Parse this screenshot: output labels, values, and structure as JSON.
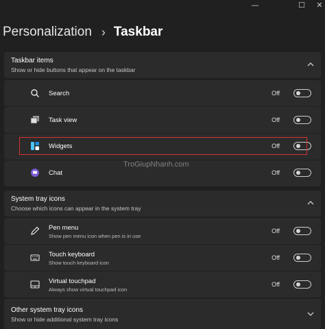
{
  "window": {
    "minimize_glyph": "—",
    "maximize_glyph": "☐",
    "close_glyph": "✕"
  },
  "breadcrumb": {
    "parent": "Personalization",
    "separator": "›",
    "current": "Taskbar"
  },
  "taskbar_items": {
    "title": "Taskbar items",
    "subtitle": "Show or hide buttons that appear on the taskbar",
    "expanded_icon": "chevron-up-icon",
    "items": [
      {
        "label": "Search",
        "state": "Off",
        "icon": "search-icon"
      },
      {
        "label": "Task view",
        "state": "Off",
        "icon": "task-view-icon"
      },
      {
        "label": "Widgets",
        "state": "Off",
        "icon": "widgets-icon"
      },
      {
        "label": "Chat",
        "state": "Off",
        "icon": "chat-icon"
      }
    ]
  },
  "system_tray": {
    "title": "System tray icons",
    "subtitle": "Choose which icons can appear in the system tray",
    "expanded_icon": "chevron-up-icon",
    "items": [
      {
        "label": "Pen menu",
        "description": "Show pen menu icon when pen is in use",
        "state": "Off",
        "icon": "pen-icon"
      },
      {
        "label": "Touch keyboard",
        "description": "Show touch keyboard icon",
        "state": "Off",
        "icon": "keyboard-icon"
      },
      {
        "label": "Virtual touchpad",
        "description": "Always show virtual touchpad icon",
        "state": "Off",
        "icon": "touchpad-icon"
      }
    ]
  },
  "other_tray": {
    "title": "Other system tray icons",
    "subtitle": "Show or hide additional system tray icons",
    "collapsed_icon": "chevron-down-icon"
  },
  "watermark": "TroGiupNhanh.com",
  "colors": {
    "background": "#202020",
    "card": "#2b2b2b",
    "highlight_border": "#d9312f",
    "widgets_accent": "#4cc2ff",
    "chat_accent": "#7b5bd6"
  }
}
